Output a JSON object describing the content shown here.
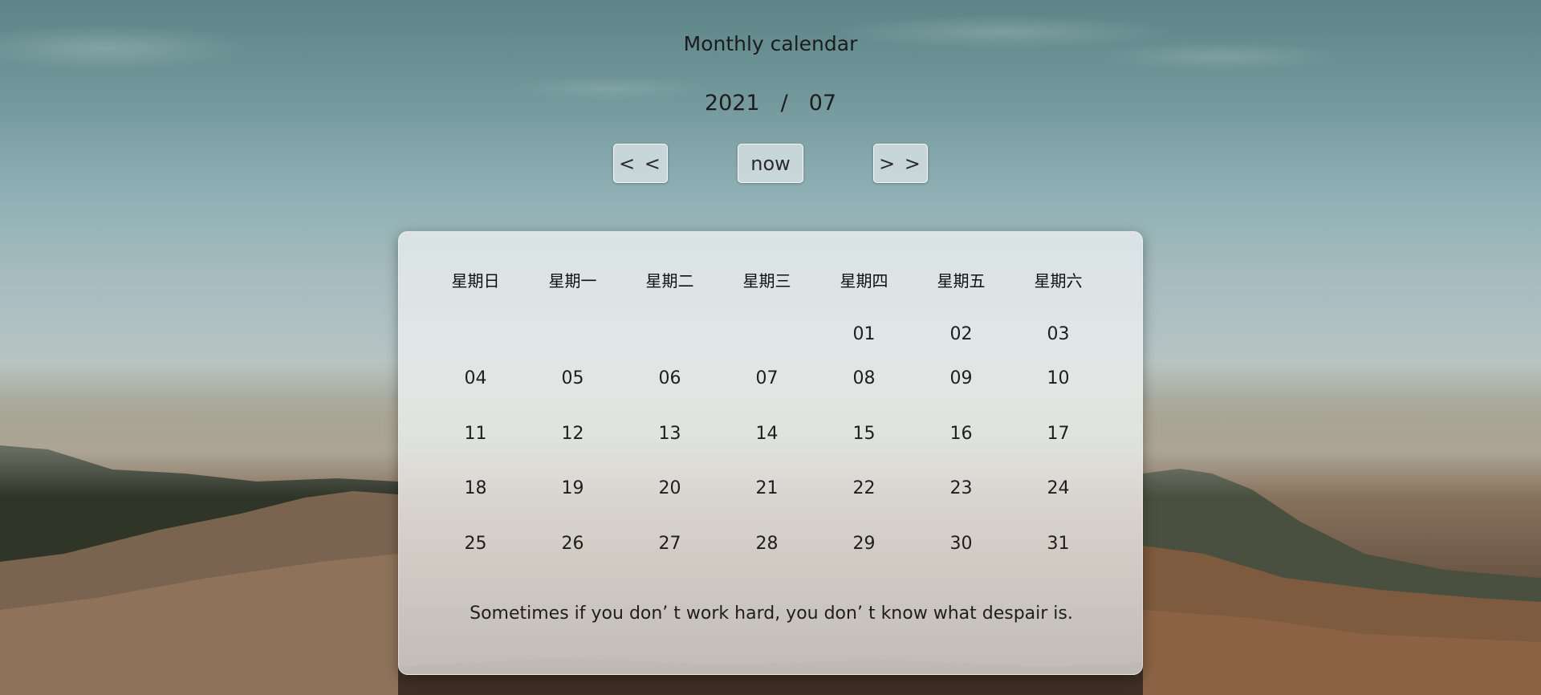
{
  "header": {
    "title": "Monthly calendar",
    "year": "2021",
    "separator": "/",
    "month": "07"
  },
  "nav": {
    "prev_label": "< <",
    "now_label": "now",
    "next_label": "> >"
  },
  "calendar": {
    "weekdays": [
      "星期日",
      "星期一",
      "星期二",
      "星期三",
      "星期四",
      "星期五",
      "星期六"
    ],
    "weeks": [
      [
        "",
        "",
        "",
        "",
        "01",
        "02",
        "03"
      ],
      [
        "04",
        "05",
        "06",
        "07",
        "08",
        "09",
        "10"
      ],
      [
        "11",
        "12",
        "13",
        "14",
        "15",
        "16",
        "17"
      ],
      [
        "18",
        "19",
        "20",
        "21",
        "22",
        "23",
        "24"
      ],
      [
        "25",
        "26",
        "27",
        "28",
        "29",
        "30",
        "31"
      ]
    ],
    "quote": "Sometimes if you don’ t work hard, you don’ t know what despair is."
  }
}
